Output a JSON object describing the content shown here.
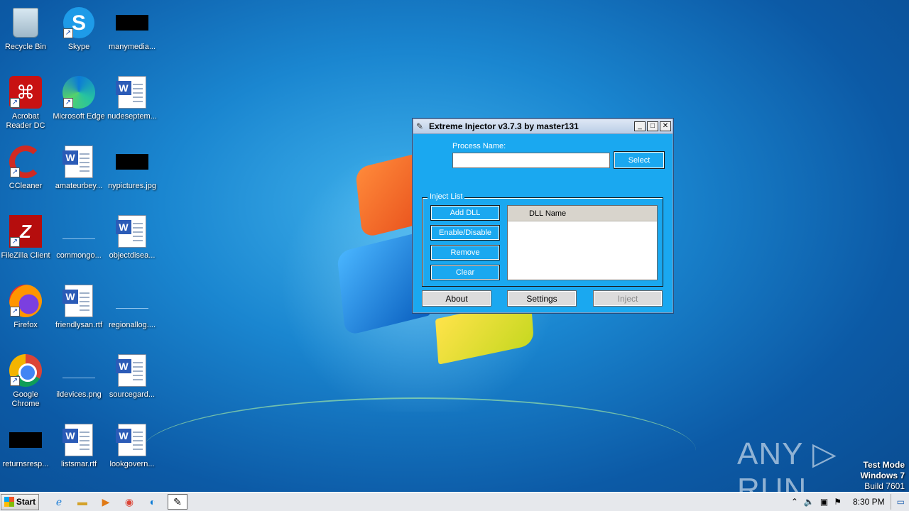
{
  "desktop": {
    "icons": [
      {
        "label": "Recycle Bin"
      },
      {
        "label": "Skype"
      },
      {
        "label": "manymedia..."
      },
      {
        "label": "Acrobat Reader DC"
      },
      {
        "label": "Microsoft Edge"
      },
      {
        "label": "nudeseptem..."
      },
      {
        "label": "CCleaner"
      },
      {
        "label": "amateurbey..."
      },
      {
        "label": "nypictures.jpg"
      },
      {
        "label": "FileZilla Client"
      },
      {
        "label": "commongo..."
      },
      {
        "label": "objectdisea..."
      },
      {
        "label": "Firefox"
      },
      {
        "label": "friendlysan.rtf"
      },
      {
        "label": "regionallog...."
      },
      {
        "label": "Google Chrome"
      },
      {
        "label": "ildevices.png"
      },
      {
        "label": "sourcegard..."
      },
      {
        "label": "returnsresp..."
      },
      {
        "label": "listsmar.rtf"
      },
      {
        "label": "lookgovern..."
      }
    ]
  },
  "window": {
    "title": "Extreme Injector v3.7.3 by master131",
    "minimize": "_",
    "maximize": "□",
    "close": "✕",
    "process_label": "Process Name:",
    "process_value": "",
    "select_label": "Select",
    "inject_list_label": "Inject List",
    "add_dll_label": "Add DLL",
    "enable_disable_label": "Enable/Disable",
    "remove_label": "Remove",
    "clear_label": "Clear",
    "dll_column_header": "DLL Name",
    "about_label": "About",
    "settings_label": "Settings",
    "inject_label": "Inject"
  },
  "watermark": {
    "text": "ANY ▷ RUN"
  },
  "system_info": {
    "line1": "Test Mode",
    "line2": "Windows 7",
    "line3": "Build 7601"
  },
  "taskbar": {
    "start_label": "Start",
    "clock": "8:30 PM"
  }
}
